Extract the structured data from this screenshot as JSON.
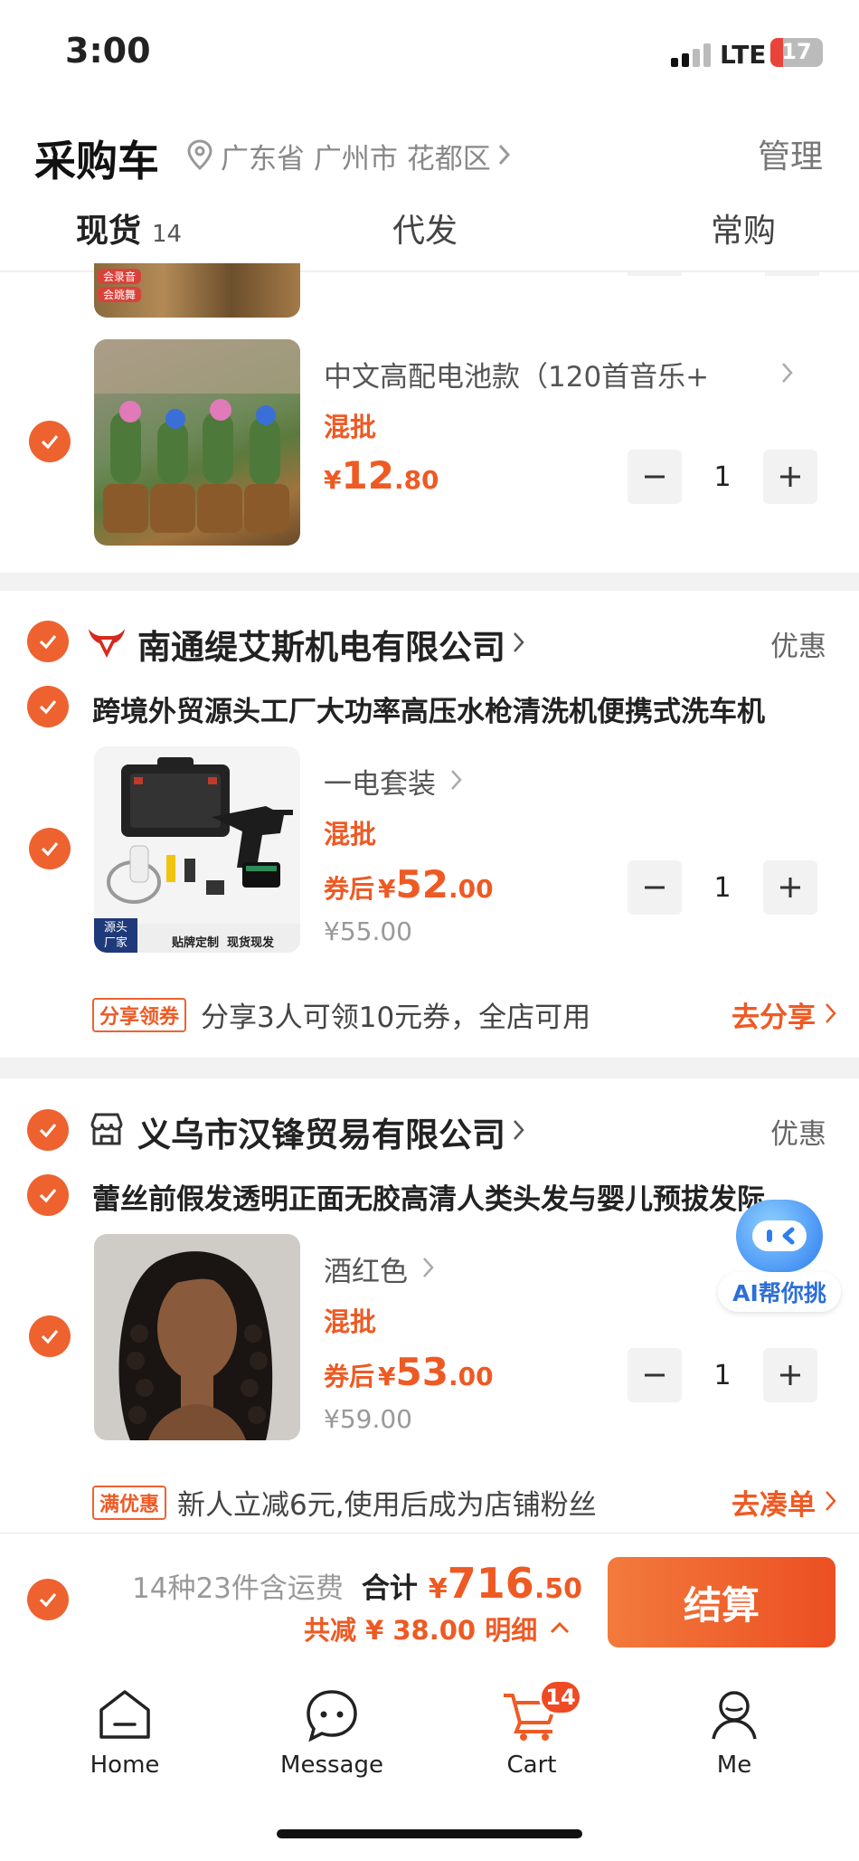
{
  "status_bar": {
    "time": "3:00",
    "network": "LTE",
    "battery": "17"
  },
  "header": {
    "title": "采购车",
    "location": "广东省 广州市 花都区",
    "manage": "管理"
  },
  "tabs": [
    {
      "label": "现货",
      "count": "14"
    },
    {
      "label": "代发"
    },
    {
      "label": "常购"
    }
  ],
  "prev_item_badges": [
    "会录音",
    "会跳舞"
  ],
  "item1": {
    "spec": "中文高配电池款（120首音乐+",
    "mix": "混批",
    "price_int": "12",
    "price_dec": ".80",
    "qty": "1"
  },
  "shop1": {
    "name": "南通缇艾斯机电有限公司",
    "discount": "优惠",
    "product_title": "跨境外贸源头工厂大功率高压水枪清洗机便携式洗车机",
    "spec": "一电套装",
    "mix": "混批",
    "price_prefix": "券后",
    "price_int": "52",
    "price_dec": ".00",
    "orig_price": "¥55.00",
    "qty": "1",
    "img_badge_1": "源头",
    "img_badge_2": "厂家",
    "img_caption": "贴牌定制  现货现发",
    "promo_tag": "分享领券",
    "promo_text": "分享3人可领10元券，全店可用",
    "promo_action": "去分享"
  },
  "shop2": {
    "name": "义乌市汉锋贸易有限公司",
    "discount": "优惠",
    "product_title": "蕾丝前假发透明正面无胶高清人类头发与婴儿预拔发际",
    "spec": "酒红色",
    "mix": "混批",
    "price_prefix": "券后",
    "price_int": "53",
    "price_dec": ".00",
    "orig_price": "¥59.00",
    "qty": "1",
    "promo_tag": "满优惠",
    "promo_text": "新人立减6元,使用后成为店铺粉丝",
    "promo_action": "去凑单"
  },
  "ai_button": {
    "label": "AI帮你挑"
  },
  "checkout": {
    "summary": "14种23件含运费",
    "total_label": "合计",
    "currency": "¥",
    "total_int": "716",
    "total_dec": ".50",
    "saved": "共减 ¥ 38.00 明细",
    "button": "结算"
  },
  "bottom_nav": [
    {
      "label": "Home"
    },
    {
      "label": "Message"
    },
    {
      "label": "Cart",
      "badge": "14"
    },
    {
      "label": "Me"
    }
  ],
  "colors": {
    "accent": "#ee5a24",
    "button": "#ef5b28"
  }
}
